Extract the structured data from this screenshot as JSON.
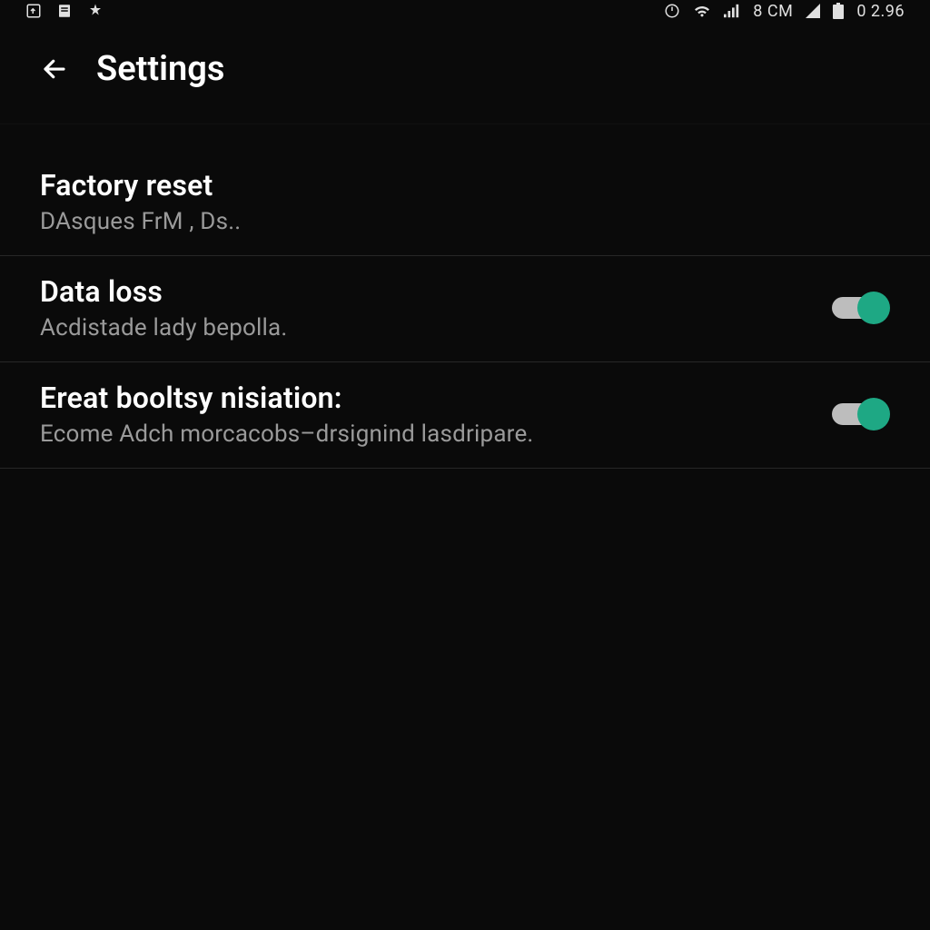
{
  "status_bar": {
    "carrier": "8 CM",
    "time": "0 2.96"
  },
  "app_bar": {
    "title": "Settings"
  },
  "settings": [
    {
      "title": "Factory reset",
      "subtitle": "DAsques FrM , Ds..",
      "has_toggle": false
    },
    {
      "title": "Data loss",
      "subtitle": "Acdistade lady bepolla.",
      "has_toggle": true,
      "toggle_on": true
    },
    {
      "title": "Ereat booltsy nisiation:",
      "subtitle": "Ecome Adch morcacobs–drsignind lasdripare.",
      "has_toggle": true,
      "toggle_on": true
    }
  ],
  "colors": {
    "accent": "#1ea884",
    "bg": "#0a0a0a",
    "text_primary": "#ffffff",
    "text_secondary": "#9a9a9a",
    "divider": "rgba(255,255,255,0.12)"
  }
}
